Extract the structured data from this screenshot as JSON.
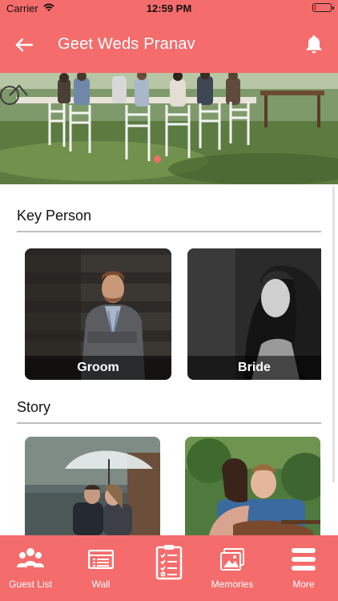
{
  "status_bar": {
    "carrier": "Carrier",
    "time": "12:59 PM"
  },
  "header": {
    "title": "Geet Weds Pranav",
    "back_icon": "arrow-left-icon",
    "bell_icon": "bell-icon"
  },
  "carousel": {
    "page_count": 3,
    "active_index": 0
  },
  "sections": {
    "key_person": {
      "title": "Key Person",
      "cards": [
        {
          "label": "Groom"
        },
        {
          "label": "Bride"
        }
      ]
    },
    "story": {
      "title": "Story"
    }
  },
  "tabbar": {
    "items": [
      {
        "label": "Guest List",
        "icon": "guests-icon"
      },
      {
        "label": "Wall",
        "icon": "wall-icon"
      },
      {
        "label": "",
        "icon": "checklist-icon"
      },
      {
        "label": "Memories",
        "icon": "photos-icon"
      },
      {
        "label": "More",
        "icon": "menu-icon"
      }
    ]
  },
  "colors": {
    "brand": "#f56c6c",
    "active_dot": "#f56c6c",
    "inactive_dot": "#d9d9d9"
  }
}
